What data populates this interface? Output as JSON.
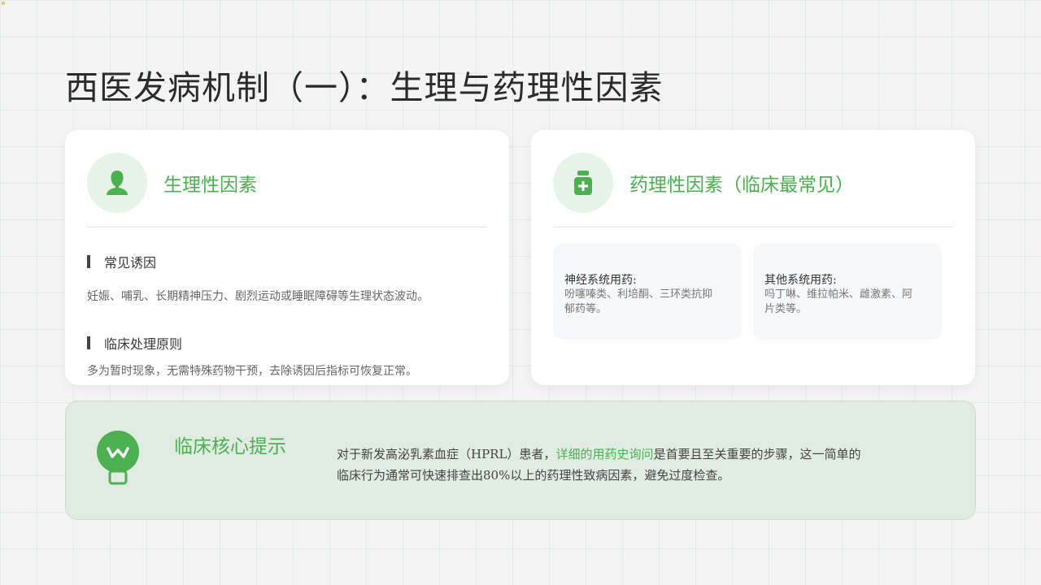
{
  "title": "西医发病机制（一）：生理与药理性因素",
  "physio": {
    "icon": "person-icon",
    "title": "生理性因素",
    "sections": [
      {
        "heading": "常见诱因",
        "text": "妊娠、哺乳、长期精神压力、剧烈运动或睡眠障碍等生理状态波动。"
      },
      {
        "heading": "临床处理原则",
        "text": "多为暂时现象，无需特殊药物干预，去除诱因后指标可恢复正常。"
      }
    ]
  },
  "pharma": {
    "icon": "medicine-bottle-icon",
    "title": "药理性因素（临床最常见）",
    "boxes": [
      {
        "title": "神经系统用药:",
        "lines": [
          "吩噻嗪类、利培酮、三环类抗抑",
          "郁药等。"
        ]
      },
      {
        "title": "其他系统用药:",
        "lines": [
          "吗丁啉、维拉帕米、雌激素、阿",
          "片类等。"
        ]
      }
    ]
  },
  "tip": {
    "icon": "lightbulb-icon",
    "title": "临床核心提示",
    "line1_before": "对于新发高泌乳素血症（HPRL）患者，",
    "line1_highlight": "详细的用药史询问",
    "line1_after": "是首要且至关重要的步骤，这一简单的",
    "line2": "临床行为通常可快速排查出80%以上的药理性致病因素，避免过度检查。"
  },
  "colors": {
    "accent": "#4caf50",
    "icon_bg": "#e6f3e7",
    "tip_bg": "#e0ebe1"
  }
}
